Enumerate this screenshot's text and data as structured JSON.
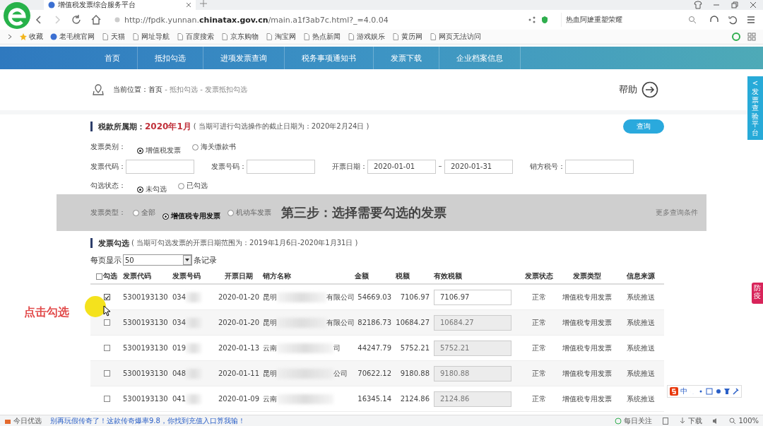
{
  "browser": {
    "tab_title": "增值税发票综合服务平台",
    "url_prefix": "http://fpdk.yunnan.",
    "url_domain": "chinatax.gov.cn",
    "url_suffix": "/main.a1f3ab7c.html?_=4.0.04",
    "search_text": "热血阿嬷重塑荣耀",
    "bookmarks": [
      {
        "label": "收藏",
        "kind": "star"
      },
      {
        "label": "老毛桃官网",
        "kind": "globe"
      },
      {
        "label": "天猫",
        "kind": "page"
      },
      {
        "label": "网址导航",
        "kind": "page"
      },
      {
        "label": "百度搜索",
        "kind": "page"
      },
      {
        "label": "京东购物",
        "kind": "page"
      },
      {
        "label": "淘宝网",
        "kind": "page"
      },
      {
        "label": "热点新闻",
        "kind": "page"
      },
      {
        "label": "游戏娱乐",
        "kind": "page"
      },
      {
        "label": "黄历网",
        "kind": "page"
      },
      {
        "label": "网页无法访问",
        "kind": "page"
      }
    ]
  },
  "nav": [
    {
      "label": "首页"
    },
    {
      "label": "抵扣勾选"
    },
    {
      "label": "进项发票查询"
    },
    {
      "label": "税务事项通知书"
    },
    {
      "label": "发票下载"
    },
    {
      "label": "企业档案信息"
    }
  ],
  "breadcrumb": {
    "label": "当前位置：",
    "home": "首页",
    "path": " - 抵扣勾选 - 发票抵扣勾选"
  },
  "help": "帮助",
  "side_tab": {
    "arrow": "<",
    "label": "发票查验平台"
  },
  "period": {
    "label": "税款所属期：",
    "value": "2020年1月",
    "note": "( 当期可进行勾选操作的截止日期为：2020年2月24日 )",
    "query_button": "查询"
  },
  "filters": {
    "category": {
      "label": "发票类别：",
      "options": [
        {
          "label": "增值税发票",
          "selected": true
        },
        {
          "label": "海关缴款书",
          "selected": false
        }
      ]
    },
    "fields": [
      {
        "label": "发票代码：",
        "kind": "text"
      },
      {
        "label": "发票号码：",
        "kind": "text"
      },
      {
        "label": "开票日期：",
        "value": "2020-01-01",
        "value_to": "2020-01-31",
        "kind": "range"
      },
      {
        "label": "销方税号：",
        "kind": "text"
      }
    ],
    "check_status": {
      "label": "勾选状态：",
      "options": [
        {
          "label": "未勾选",
          "selected": true
        },
        {
          "label": "已勾选",
          "selected": false
        }
      ]
    },
    "invoice_type": {
      "label": "发票类型：",
      "options": [
        {
          "label": "全部",
          "selected": false
        },
        {
          "label": "增值税专用发票",
          "selected": true
        },
        {
          "label": "机动车发票",
          "selected": false
        }
      ]
    },
    "more": "更多查询条件"
  },
  "caption": "第三步：选择需要勾选的发票",
  "selection": {
    "title": "发票勾选",
    "note": "( 当期可勾选发票的开票日期范围为：2019年1月6日-2020年1月31日 )",
    "page_size_label": "每页显示",
    "page_size": "50",
    "page_size_suffix": "条记录",
    "columns": [
      "勾选",
      "发票代码",
      "发票号码",
      "开票日期",
      "销方名称",
      "金额",
      "税额",
      "有效税额",
      "发票状态",
      "发票类型",
      "信息来源"
    ],
    "select_all": false,
    "rows": [
      {
        "checked": true,
        "code": "5300193130",
        "number": "034",
        "date": "2020-01-20",
        "seller_start": "昆明",
        "seller_end": "有限公司",
        "amount": "54669.03",
        "tax": "7106.97",
        "valid_tax": "7106.97",
        "editable": true,
        "status": "正常",
        "type": "增值税专用发票",
        "source": "系统推送"
      },
      {
        "checked": false,
        "code": "5300193130",
        "number": "034",
        "date": "2020-01-20",
        "seller_start": "昆明",
        "seller_end": "有限公司",
        "amount": "82186.73",
        "tax": "10684.27",
        "valid_tax": "10684.27",
        "editable": false,
        "status": "正常",
        "type": "增值税专用发票",
        "source": "系统推送"
      },
      {
        "checked": false,
        "code": "5300193130",
        "number": "019",
        "date": "2020-01-13",
        "seller_start": "云南",
        "seller_end": "司",
        "amount": "44247.79",
        "tax": "5752.21",
        "valid_tax": "5752.21",
        "editable": false,
        "status": "正常",
        "type": "增值税专用发票",
        "source": "系统推送"
      },
      {
        "checked": false,
        "code": "5300193130",
        "number": "048",
        "date": "2020-01-11",
        "seller_start": "昆明",
        "seller_end": "公司",
        "amount": "70622.12",
        "tax": "9180.88",
        "valid_tax": "9180.88",
        "editable": false,
        "status": "正常",
        "type": "增值税专用发票",
        "source": "系统推送"
      },
      {
        "checked": false,
        "code": "5300193130",
        "number": "041",
        "date": "2020-01-09",
        "seller_start": "云南",
        "seller_end": "",
        "amount": "16345.14",
        "tax": "2124.86",
        "valid_tax": "2124.86",
        "editable": false,
        "status": "正常",
        "type": "增值税专用发票",
        "source": "系统推送"
      }
    ]
  },
  "annotation": "点击勾选",
  "epidemic_badge": "防疫",
  "ime_toolbar": {
    "mode": "中"
  },
  "status_bar": {
    "left": "今日优选",
    "news": "别再玩假传奇了！这款传奇爆率9.8，你找到充值入口算我输！",
    "follow": "每日关注",
    "download": "下载",
    "zoom": "100%"
  }
}
